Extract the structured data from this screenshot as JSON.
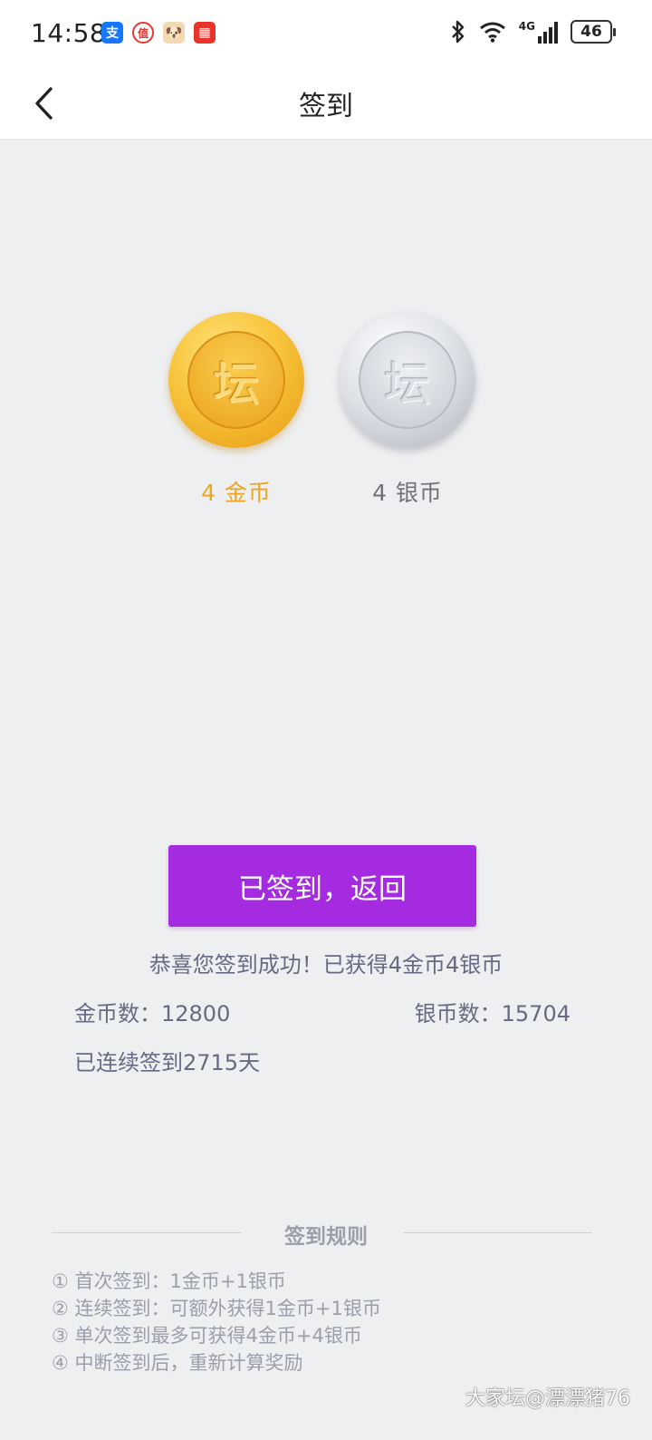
{
  "status_bar": {
    "time": "14:58",
    "notifications": [
      {
        "icon": "alipay-icon",
        "glyph": "支",
        "color": "#1677ff"
      },
      {
        "icon": "smzdm-icon",
        "glyph": "值",
        "color": "#e8372f"
      },
      {
        "icon": "dog-app-icon",
        "glyph": "🐶",
        "color": "#f3d9b1"
      },
      {
        "icon": "news-app-icon",
        "glyph": "▦",
        "color": "#e8332a"
      }
    ],
    "network": "4G",
    "battery": "46"
  },
  "header": {
    "title": "签到"
  },
  "coins": {
    "gold": {
      "glyph": "坛",
      "label": "4 金币",
      "color": "#eda420"
    },
    "silver": {
      "glyph": "坛",
      "label": "4 银币",
      "color": "#70727a"
    }
  },
  "action": {
    "return_label": "已签到，返回",
    "color": "#a42be0"
  },
  "result": {
    "message": "恭喜您签到成功！已获得4金币4银币",
    "gold_count": "金币数：12800",
    "silver_count": "银币数：15704",
    "streak": "已连续签到2715天"
  },
  "rules": {
    "title": "签到规则",
    "items": [
      "① 首次签到：1金币+1银币",
      "② 连续签到：可额外获得1金币+1银币",
      "③ 单次签到最多可获得4金币+4银币",
      "④ 中断签到后，重新计算奖励"
    ]
  },
  "watermark": "大家坛@漂漂猪76"
}
